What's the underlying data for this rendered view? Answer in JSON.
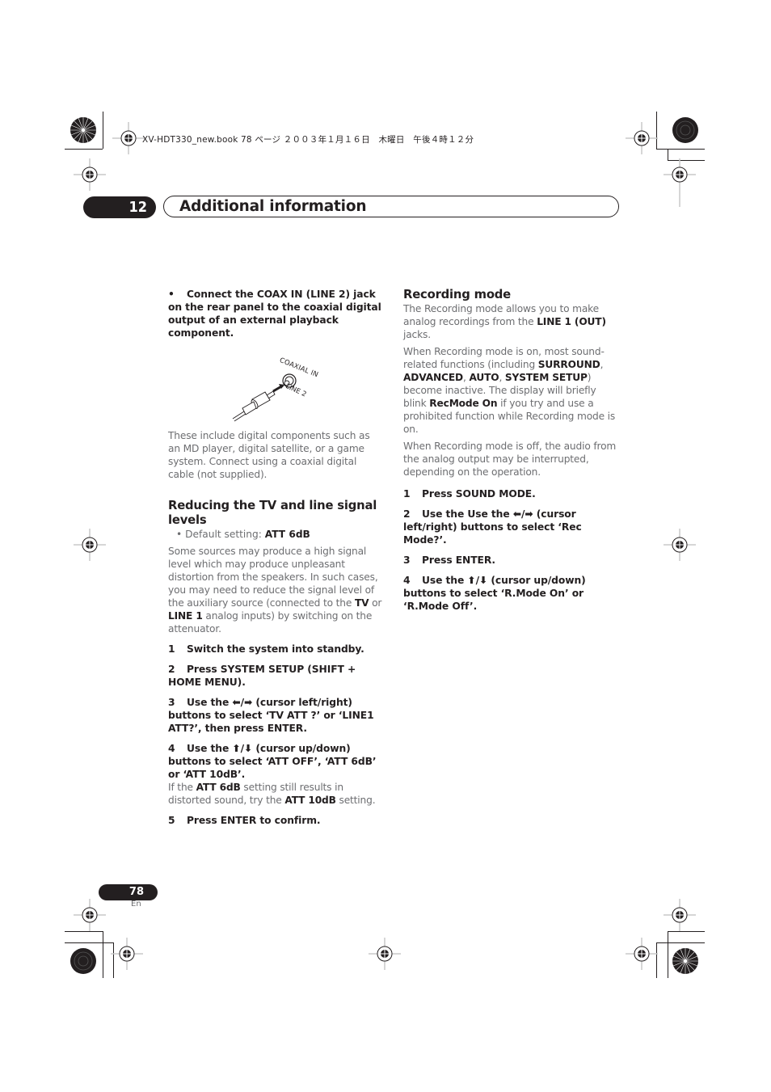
{
  "print_header": {
    "file_info": "XV-HDT330_new.book 78 ページ ２００３年１月１６日　木曜日　午後４時１２分"
  },
  "chapter": {
    "number": "12",
    "title": "Additional information"
  },
  "left_column": {
    "intro_step": {
      "bullet": "•",
      "text": "Connect the COAX IN (LINE 2) jack on the rear panel to the coaxial digital output of an external playback component."
    },
    "figure": {
      "label_top": "COAXIAL IN",
      "label_bottom": "LINE 2"
    },
    "figure_caption": "These include digital components such as an MD player, digital satellite, or a game system. Connect using a coaxial digital cable (not supplied).",
    "section_title": "Reducing the TV and line signal levels",
    "default_setting": {
      "label": "Default setting: ",
      "value": "ATT 6dB"
    },
    "description": {
      "p1": "Some sources may produce a high signal level which may produce unpleasant distortion from the speakers. In such cases, you may need to reduce the signal level of the auxiliary source (connected to the ",
      "b1": "TV",
      "p2": " or ",
      "b2": "LINE 1",
      "p3": " analog inputs) by switching on the attenuator."
    },
    "steps": [
      {
        "num": "1",
        "text": "Switch the system into standby."
      },
      {
        "num": "2",
        "text": "Press SYSTEM SETUP (SHIFT + HOME MENU)."
      },
      {
        "num": "3",
        "text_a": "Use  the ",
        "arrows": "⬅/➡",
        "text_b": " (cursor left/right) buttons to select ‘TV ATT ?’ or ‘LINE1 ATT?’, then press ENTER."
      },
      {
        "num": "4",
        "text_a": "Use the ",
        "arrows": "⬆/⬇",
        "text_b": " (cursor up/down) buttons to select ‘ATT OFF’, ‘ATT 6dB’ or ‘ATT 10dB’."
      },
      {
        "num": "5",
        "text": "Press ENTER to confirm."
      }
    ],
    "step4_note": {
      "p1": "If the ",
      "b1": "ATT 6dB",
      "p2": " setting still results in distorted sound, try the ",
      "b2": "ATT 10dB",
      "p3": " setting."
    }
  },
  "right_column": {
    "section_title": "Recording mode",
    "para1": {
      "p1": "The Recording mode allows you to make analog recordings from the ",
      "b1": "LINE 1 (OUT)",
      "p2": " jacks."
    },
    "para2": {
      "p1": "When Recording mode is on, most sound-related functions (including ",
      "b1": "SURROUND",
      "s1": ", ",
      "b2": "ADVANCED",
      "s2": ", ",
      "b3": "AUTO",
      "s3": ", ",
      "b4": "SYSTEM SETUP",
      "p2": ") become inactive. The display will briefly blink ",
      "b5": "RecMode On",
      "p3": " if you try and use a prohibited function while Recording mode is on."
    },
    "para3": "When Recording mode is off, the audio from the analog output may be interrupted, depending on the operation.",
    "steps": [
      {
        "num": "1",
        "text": "Press SOUND MODE."
      },
      {
        "num": "2",
        "text_a": "Use the Use the ",
        "arrows": "⬅/➡",
        "text_b": " (cursor left/right) buttons to select ‘Rec Mode?’."
      },
      {
        "num": "3",
        "text": "Press ENTER."
      },
      {
        "num": "4",
        "text_a": "Use  the ",
        "arrows": "⬆/⬇",
        "text_b": " (cursor up/down) buttons to select ‘R.Mode On’ or ‘R.Mode Off’."
      }
    ]
  },
  "footer": {
    "page_number": "78",
    "language": "En"
  }
}
